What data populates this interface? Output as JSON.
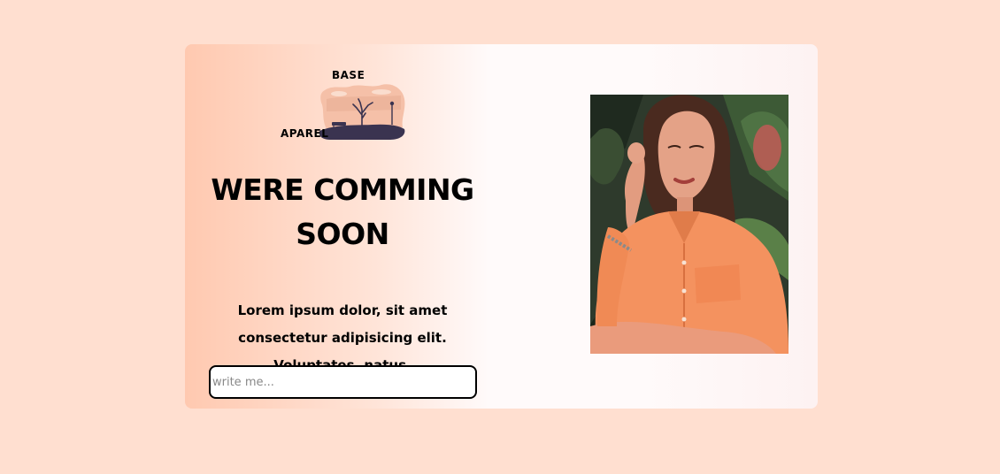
{
  "brand": {
    "line1": "BASE",
    "line2": "APAREL"
  },
  "headline": "WERE COMMING SOON",
  "subtext": "Lorem ipsum dolor, sit amet consectetur adipisicing elit. Voluptates, natus.",
  "signup": {
    "placeholder": "write me..."
  },
  "colors": {
    "page_background": "#ffdfd0",
    "accent_peach": "#ffc9b0",
    "shirt_orange": "#f4925f",
    "text": "#000000"
  },
  "icons": {
    "logo": "tree-landscape-logo",
    "hero": "model-portrait-photo"
  }
}
